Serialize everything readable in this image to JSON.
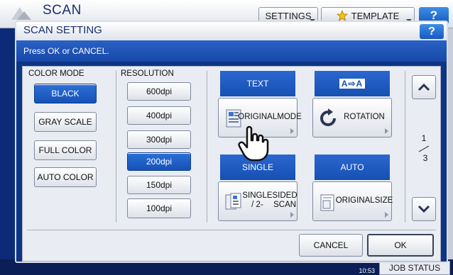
{
  "app": {
    "title": "SCAN",
    "settings_tab": "SETTINGS",
    "template_tab": "TEMPLATE",
    "help": "?",
    "time": "10:53",
    "job_status": "JOB STATUS"
  },
  "dialog": {
    "title": "SCAN SETTING",
    "help": "?",
    "message": "Press OK or CANCEL.",
    "color_mode": {
      "label": "COLOR MODE",
      "options": [
        "BLACK",
        "GRAY SCALE",
        "FULL COLOR",
        "AUTO COLOR"
      ],
      "selected": "BLACK"
    },
    "resolution": {
      "label": "RESOLUTION",
      "options": [
        "600dpi",
        "400dpi",
        "300dpi",
        "200dpi",
        "150dpi",
        "100dpi"
      ],
      "selected": "200dpi"
    },
    "functions": [
      {
        "header": "TEXT",
        "label_line1": "ORIGINAL",
        "label_line2": "MODE",
        "icon": "original-mode-icon"
      },
      {
        "header": "A⇨A",
        "label_line1": "ROTATION",
        "label_line2": "",
        "icon": "rotation-icon"
      },
      {
        "header": "SINGLE",
        "label_line1": "SINGLE / 2-",
        "label_line2": "SIDED SCAN",
        "icon": "duplex-scan-icon"
      },
      {
        "header": "AUTO",
        "label_line1": "ORIGINAL",
        "label_line2": "SIZE",
        "icon": "original-size-icon"
      }
    ],
    "page": {
      "current": "1",
      "total": "3"
    },
    "cancel": "CANCEL",
    "ok": "OK"
  },
  "colors": {
    "selected": "#1552b8",
    "header_blue": "#1650b3",
    "background_navy": "#0c2a78"
  }
}
